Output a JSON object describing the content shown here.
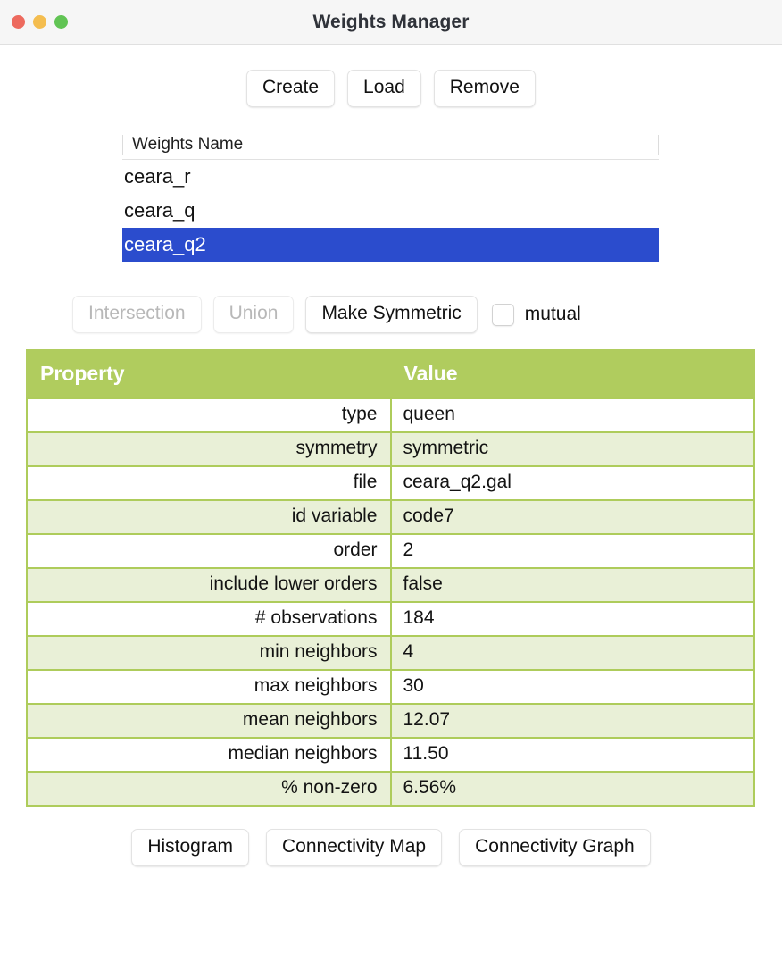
{
  "window": {
    "title": "Weights Manager",
    "traffic_lights": [
      {
        "name": "close",
        "color": "#ed6a5e"
      },
      {
        "name": "minimize",
        "color": "#f4bd4f"
      },
      {
        "name": "maximize",
        "color": "#61c454"
      }
    ]
  },
  "toolbar_top": {
    "create_label": "Create",
    "load_label": "Load",
    "remove_label": "Remove"
  },
  "weights_list": {
    "column_header": "Weights Name",
    "items": [
      {
        "name": "ceara_r",
        "selected": false
      },
      {
        "name": "ceara_q",
        "selected": false
      },
      {
        "name": "ceara_q2",
        "selected": true
      }
    ],
    "selection_color": "#2b4ccd"
  },
  "toolbar_symmetry": {
    "intersection_label": "Intersection",
    "intersection_enabled": false,
    "union_label": "Union",
    "union_enabled": false,
    "make_symmetric_label": "Make Symmetric",
    "make_symmetric_enabled": true,
    "mutual_label": "mutual",
    "mutual_checked": false
  },
  "property_table": {
    "headers": {
      "property": "Property",
      "value": "Value"
    },
    "header_color": "#b0cc5e",
    "alt_row_color": "#e9f0d7",
    "rows": [
      {
        "property": "type",
        "value": "queen"
      },
      {
        "property": "symmetry",
        "value": "symmetric"
      },
      {
        "property": "file",
        "value": "ceara_q2.gal"
      },
      {
        "property": "id variable",
        "value": "code7"
      },
      {
        "property": "order",
        "value": "2"
      },
      {
        "property": "include lower orders",
        "value": "false"
      },
      {
        "property": "# observations",
        "value": "184"
      },
      {
        "property": "min neighbors",
        "value": "4"
      },
      {
        "property": "max neighbors",
        "value": "30"
      },
      {
        "property": "mean neighbors",
        "value": "12.07"
      },
      {
        "property": "median neighbors",
        "value": "11.50"
      },
      {
        "property": "% non-zero",
        "value": "6.56%"
      }
    ]
  },
  "toolbar_bottom": {
    "histogram_label": "Histogram",
    "connectivity_map_label": "Connectivity Map",
    "connectivity_graph_label": "Connectivity Graph"
  }
}
